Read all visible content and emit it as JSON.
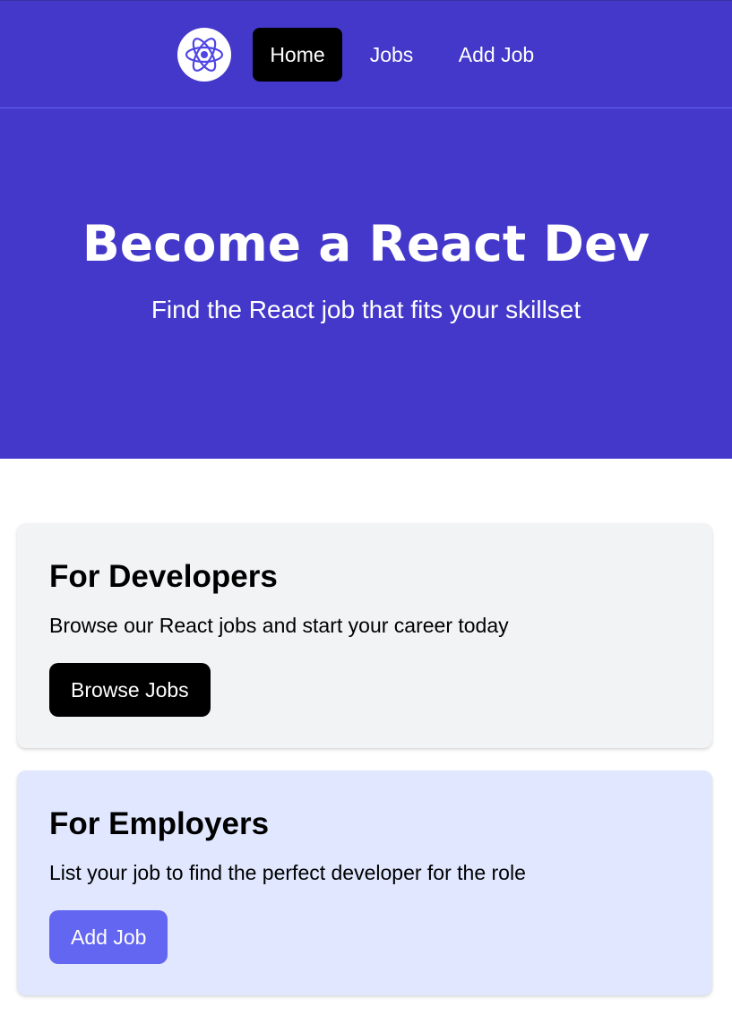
{
  "nav": {
    "logo_icon": "react-atom-icon",
    "links": [
      {
        "label": "Home",
        "active": true
      },
      {
        "label": "Jobs",
        "active": false
      },
      {
        "label": "Add Job",
        "active": false
      }
    ]
  },
  "hero": {
    "title": "Become a React Dev",
    "subtitle": "Find the React job that fits your skillset"
  },
  "cards": {
    "developers": {
      "title": "For Developers",
      "text": "Browse our React jobs and start your career today",
      "button_label": "Browse Jobs"
    },
    "employers": {
      "title": "For Employers",
      "text": "List your job to find the perfect developer for the role",
      "button_label": "Add Job"
    }
  },
  "colors": {
    "brand": "#4338ca",
    "accent": "#6366f1",
    "developers_card_bg": "#f2f3f5",
    "employers_card_bg": "#e0e7ff"
  }
}
